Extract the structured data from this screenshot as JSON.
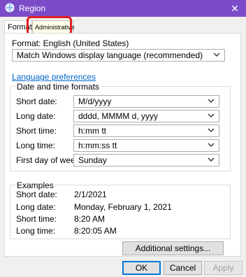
{
  "window": {
    "title": "Region",
    "close_glyph": "✕"
  },
  "tabs": [
    {
      "label": "Formats"
    },
    {
      "label": "Administrative"
    }
  ],
  "formats": {
    "format_label": "Format: English (United States)",
    "format_value": "Match Windows display language (recommended)",
    "language_link": "Language preferences",
    "datetime_group_title": "Date and time formats",
    "rows": [
      {
        "label": "Short date:",
        "value": "M/d/yyyy"
      },
      {
        "label": "Long date:",
        "value": "dddd, MMMM d, yyyy"
      },
      {
        "label": "Short time:",
        "value": "h:mm tt"
      },
      {
        "label": "Long time:",
        "value": "h:mm:ss tt"
      },
      {
        "label": "First day of week:",
        "value": "Sunday"
      }
    ],
    "examples_group_title": "Examples",
    "examples": [
      {
        "label": "Short date:",
        "value": "2/1/2021"
      },
      {
        "label": "Long date:",
        "value": "Monday, February 1, 2021"
      },
      {
        "label": "Short time:",
        "value": "8:20 AM"
      },
      {
        "label": "Long time:",
        "value": "8:20:05 AM"
      }
    ],
    "additional_settings": "Additional settings..."
  },
  "footer": {
    "ok": "OK",
    "cancel": "Cancel",
    "apply": "Apply"
  },
  "colors": {
    "titlebar": "#7c4bc7",
    "highlight": "#e32020",
    "link": "#0066cc"
  }
}
